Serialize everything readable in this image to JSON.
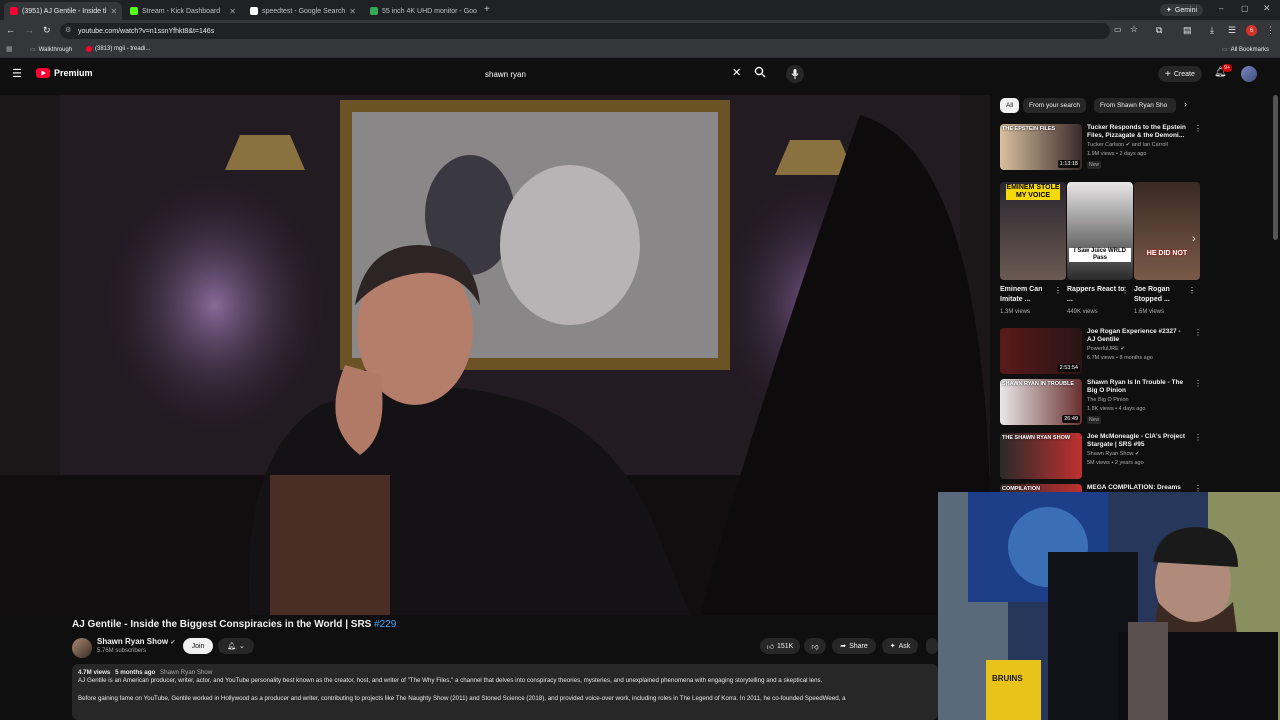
{
  "browser": {
    "tabs": [
      {
        "label": "(3951) AJ Gentile - Inside tl",
        "color": "#ff0033",
        "active": true
      },
      {
        "label": "Stream - Kick Dashboard",
        "color": "#53fc18",
        "active": false
      },
      {
        "label": "speedtest - Google Search",
        "color": "#ffffff",
        "active": false
      },
      {
        "label": "55 inch 4K UHD monitor - Goo",
        "color": "#34a853",
        "active": false
      }
    ],
    "new_tab_label": "+",
    "gemini_label": "Gemini",
    "url": "youtube.com/watch?v=n1ssnYfhkt8&t=146s",
    "bookmarks": [
      {
        "label": "Walkthrough"
      },
      {
        "label": "(3813) mgii - treadi..."
      }
    ],
    "all_bookmarks_label": "All Bookmarks",
    "profile_initial": "6"
  },
  "youtube": {
    "logo_label": "Premium",
    "search_value": "shawn ryan",
    "create_label": "Create",
    "notif_count": "9+"
  },
  "video": {
    "title": "AJ Gentile - Inside the Biggest Conspiracies in the World | SRS ",
    "hashtag": "#229",
    "channel": "Shawn Ryan Show",
    "subscribers": "5.76M subscribers",
    "join_label": "Join",
    "likes": "151K",
    "share_label": "Share",
    "ask_label": "Ask",
    "views": "4.7M views",
    "age": "5 months ago",
    "desc_channel": "Shawn Ryan Show",
    "desc_line1": "AJ Gentile is an American producer, writer, actor, and YouTube personality best known as the creator, host, and writer of \"The Why Files,\" a channel that delves into conspiracy theories, mysteries, and unexplained phenomena with engaging storytelling and a skeptical lens.",
    "desc_line2": "Before gaining fame on YouTube, Gentile worked in Hollywood as a producer and writer, contributing to projects like The Naughty Show (2011) and Stoned Science (2018), and provided voice-over work, including roles in The Legend of Korra. In 2011, he co-founded SpeedWeed, a"
  },
  "sidebar": {
    "chips": [
      "All",
      "From your search",
      "From Shawn Ryan Sho"
    ],
    "related": [
      {
        "title": "Tucker Responds to the Epstein Files, Pizzagate & the Demoni...",
        "channel": "Tucker Carlson ✔ and Ian Carroll",
        "meta": "1.9M views • 2 days ago",
        "duration": "1:13:18",
        "badge": "New",
        "thumb_text": "THE EPSTEIN FILES"
      },
      {
        "title": "Joe Rogan Experience #2327 - AJ Gentile",
        "channel": "PowerfulJRE ✔",
        "meta": "6.7M views • 8 months ago",
        "duration": "2:53:54",
        "badge": "",
        "thumb_text": ""
      },
      {
        "title": "Shawn Ryan Is In Trouble - The Big O Pinion",
        "channel": "The Big O Pinion",
        "meta": "1.8K views • 4 days ago",
        "duration": "26:49",
        "badge": "New",
        "thumb_text": "SHAWN RYAN IN TROUBLE"
      },
      {
        "title": "Joe McMoneagle - CIA's Project Stargate | SRS #95",
        "channel": "Shawn Ryan Show ✔",
        "meta": "5M views • 2 years ago",
        "duration": "",
        "badge": "",
        "thumb_text": "THE SHAWN RYAN SHOW"
      },
      {
        "title": "MEGA COMPILATION: Dreams",
        "channel": "",
        "meta": "",
        "duration": "",
        "badge": "",
        "thumb_text": "COMPILATION"
      }
    ],
    "shorts": [
      {
        "title": "Eminem Can Imitate ...",
        "views": "1.3M views",
        "overlay": "EMINEM STOLE MY VOICE"
      },
      {
        "title": "Rappers React to ...",
        "views": "449K views",
        "overlay": "I Saw Juice WRLD Pass"
      },
      {
        "title": "Joe Rogan Stopped ...",
        "views": "1.6M views",
        "overlay": "HE DID NOT"
      }
    ]
  },
  "webcam": {
    "hat_text": "BRUINS"
  }
}
